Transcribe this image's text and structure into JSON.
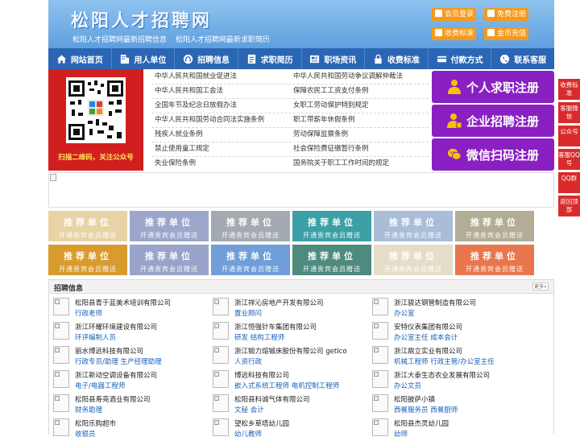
{
  "header": {
    "title": "松阳人才招聘网",
    "subtitle": [
      "松阳人才招聘网最新招聘信息",
      "松阳人才招聘网最新求职简历"
    ],
    "buttons": [
      "会员登录",
      "免费注册",
      "收费标准",
      "金币充值"
    ],
    "button_color": "#f39a1e"
  },
  "nav": {
    "items": [
      {
        "label": "网站首页",
        "icon": "home-icon"
      },
      {
        "label": "用人单位",
        "icon": "building-icon"
      },
      {
        "label": "招聘信息",
        "icon": "headset-icon"
      },
      {
        "label": "求职简历",
        "icon": "resume-icon"
      },
      {
        "label": "职场资讯",
        "icon": "news-icon"
      },
      {
        "label": "收费标准",
        "icon": "lock-icon"
      },
      {
        "label": "付款方式",
        "icon": "card-icon"
      },
      {
        "label": "联系客服",
        "icon": "phone-icon"
      }
    ],
    "color": "#2a66b4"
  },
  "qr": {
    "caption": "扫描二维码，关注公众号"
  },
  "laws": {
    "left": [
      "中华人民共和国就业促进法",
      "中华人民共和国工会法",
      "全国年节及纪念日放假办法",
      "中华人民共和国劳动合同法实施条例",
      "残疾人就业条例",
      "禁止使用童工规定",
      "失业保险条例"
    ],
    "right": [
      "中华人民共和国劳动争议调解仲裁法",
      "保障农民工工资支付条例",
      "女职工劳动保护特别规定",
      "职工带薪年休假条例",
      "劳动保障监察条例",
      "社会保险费征缴暂行条例",
      "国务院关于职工工作时间的规定"
    ]
  },
  "register": {
    "buttons": [
      "个人求职注册",
      "企业招聘注册",
      "微信扫码注册"
    ],
    "color": "#8a1fc2"
  },
  "recommend": {
    "title": "推荐单位",
    "sub": "开通贵宾会员赠送",
    "row1_colors": [
      "#e8d3a6",
      "#9da7cc",
      "#a4aab2",
      "#3aa0a6",
      "#a9bdd8",
      "#b3ad96"
    ],
    "row2_colors": [
      "#d99b2e",
      "#9aa3c9",
      "#6f9ed8",
      "#4e8b7f",
      "#e6ddc8",
      "#e8774e"
    ]
  },
  "jobs": {
    "title": "招聘信息",
    "more": "更多»",
    "items": [
      {
        "company": "松阳县青于蓝美术培训有限公司",
        "position": "行政老师"
      },
      {
        "company": "浙江祥沁房地产开发有限公司",
        "position": "置业顾问"
      },
      {
        "company": "浙江骏达钢管制造有限公司",
        "position": "办公室"
      },
      {
        "company": "浙江环耀环境建设有限公司",
        "position": "环评编制人员"
      },
      {
        "company": "浙江恒强针车集团有限公司",
        "position": "研发 结构工程师"
      },
      {
        "company": "安特仪表集团有限公司",
        "position": "办公室主任 成本会计"
      },
      {
        "company": "丽水博远科技有限公司",
        "position": "行政专员/助理 生产经理助理"
      },
      {
        "company": "浙江锻力熔锻床股份有限公司 getIco",
        "position": "人资行政"
      },
      {
        "company": "浙江鼎立实业有限公司",
        "position": "机械工程师 行政主管/办公室主任"
      },
      {
        "company": "浙江新动空调设备有限公司",
        "position": "电子/电器工程师"
      },
      {
        "company": "博远科技有限公司",
        "position": "嵌入式系统工程师 电机控制工程师"
      },
      {
        "company": "浙江大泰生态农业发展有限公司",
        "position": "办公文员"
      },
      {
        "company": "松阳县寿亮酒业有限公司",
        "position": "财务助理"
      },
      {
        "company": "松阳县科诚气体有限公司",
        "position": "文秘 会计"
      },
      {
        "company": "松阳披萨小镇",
        "position": "西餐服务员 西餐厨师"
      },
      {
        "company": "松阳乐购超市",
        "position": "收银员"
      },
      {
        "company": "望松乡草塔幼儿园",
        "position": "幼儿教师"
      },
      {
        "company": "松阳县杰灵幼儿园",
        "position": "幼师"
      }
    ]
  },
  "float": {
    "items": [
      "收费标准",
      "客服微信",
      "公众号",
      "客服QQ号",
      "QQ群",
      "返回顶部"
    ],
    "color": "#d92b2b"
  }
}
